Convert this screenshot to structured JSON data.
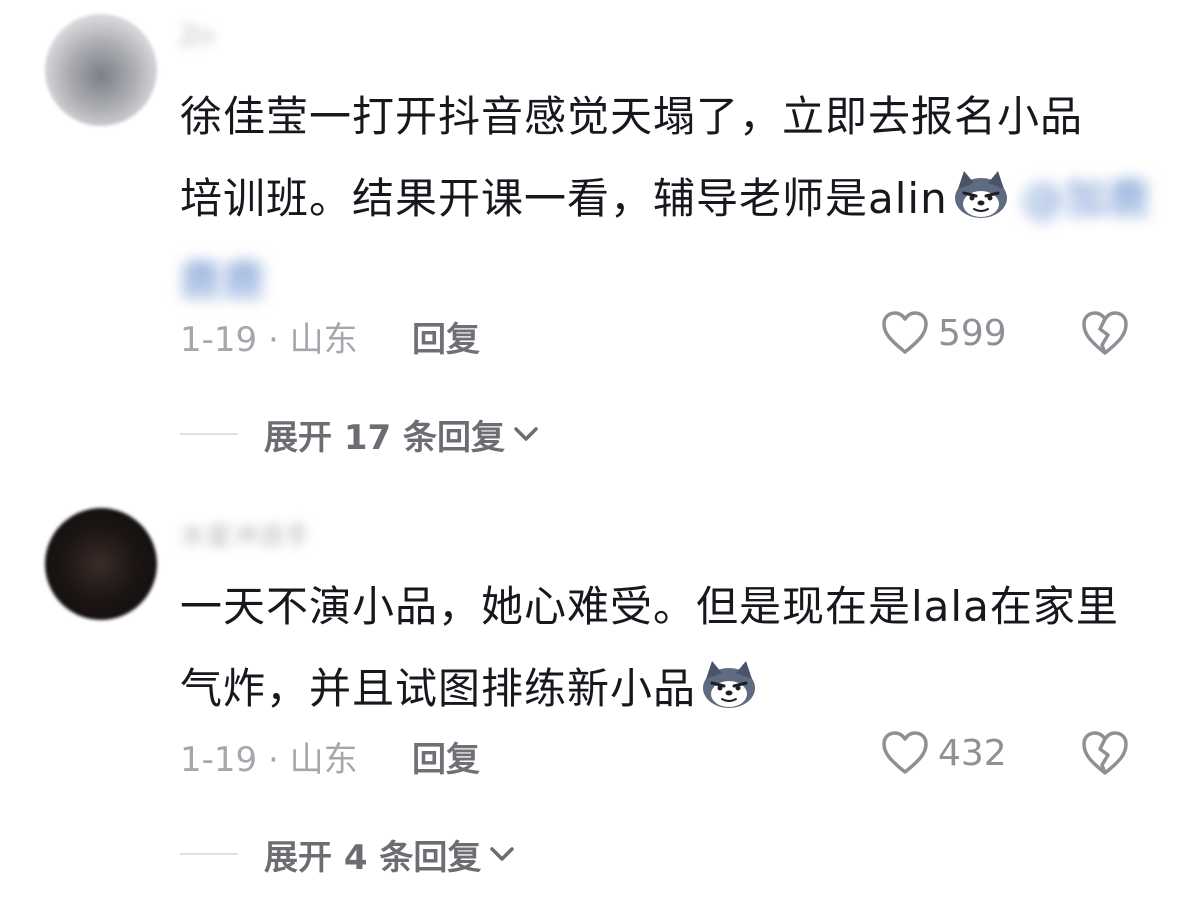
{
  "comments": [
    {
      "username": "Zn",
      "lines": [
        "徐佳莹一打开抖音感觉天塌了，立即去报名小品",
        "培训班。结果开课一看，辅导老师是alin",
        "@加鹿"
      ],
      "mention_inline": "@加鹿",
      "mention_line": "鹿鹿",
      "date_location": "1-19 · 山东",
      "reply_label": "回复",
      "like_count": "599",
      "expand_label": "展开 17 条回复"
    },
    {
      "username": "水星冲浪手",
      "lines": [
        "一天不演小品，她心难受。但是现在是lala在家里",
        "气炸，并且试图排练新小品"
      ],
      "date_location": "1-19 · 山东",
      "reply_label": "回复",
      "like_count": "432",
      "expand_label": "展开 4 条回复"
    }
  ],
  "icons": {
    "emoji": "wolf-face-emoji-icon",
    "like": "heart-outline-icon",
    "dislike": "broken-heart-icon",
    "expand": "chevron-down-icon"
  },
  "colors": {
    "text": "#16181d",
    "meta": "#a6a7ad",
    "reply": "#6f7076",
    "mention": "#5b86c9",
    "background": "#ffffff"
  }
}
